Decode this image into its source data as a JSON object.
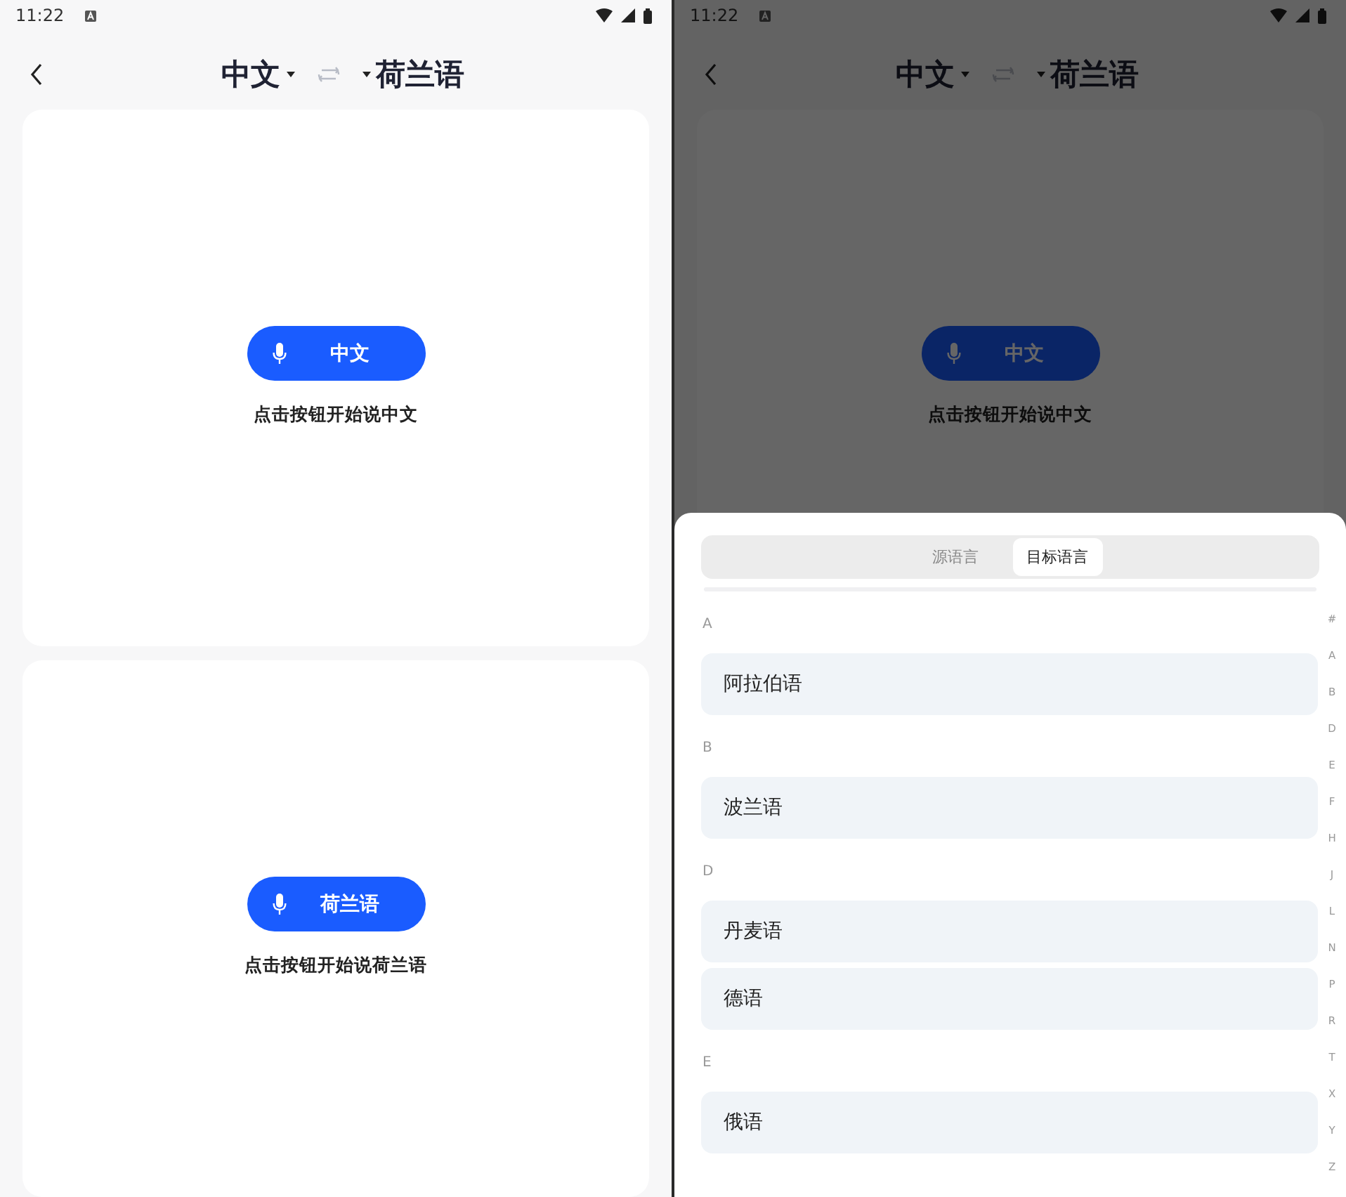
{
  "screens": [
    {
      "status_bar": {
        "time": "11:22"
      },
      "header": {
        "source": "中文",
        "target": "荷兰语"
      },
      "dimmed": false,
      "panels": [
        {
          "button": "中文",
          "hint": "点击按钮开始说中文"
        },
        {
          "button": "荷兰语",
          "hint": "点击按钮开始说荷兰语"
        }
      ]
    },
    {
      "status_bar": {
        "time": "11:22"
      },
      "header": {
        "source": "中文",
        "target": "荷兰语"
      },
      "dimmed": true,
      "panels": [
        {
          "button": "中文",
          "hint": "点击按钮开始说中文"
        }
      ],
      "language_sheet": {
        "tabs": [
          {
            "label": "源语言",
            "selected": false
          },
          {
            "label": "目标语言",
            "selected": true
          }
        ],
        "sections": [
          {
            "letter": "A",
            "items": [
              "阿拉伯语"
            ]
          },
          {
            "letter": "B",
            "items": [
              "波兰语"
            ]
          },
          {
            "letter": "D",
            "items": [
              "丹麦语",
              "德语"
            ]
          },
          {
            "letter": "E",
            "items": [
              "俄语"
            ]
          }
        ],
        "index": [
          "#",
          "A",
          "B",
          "D",
          "E",
          "F",
          "H",
          "J",
          "L",
          "N",
          "P",
          "R",
          "T",
          "X",
          "Y",
          "Z"
        ]
      }
    }
  ]
}
